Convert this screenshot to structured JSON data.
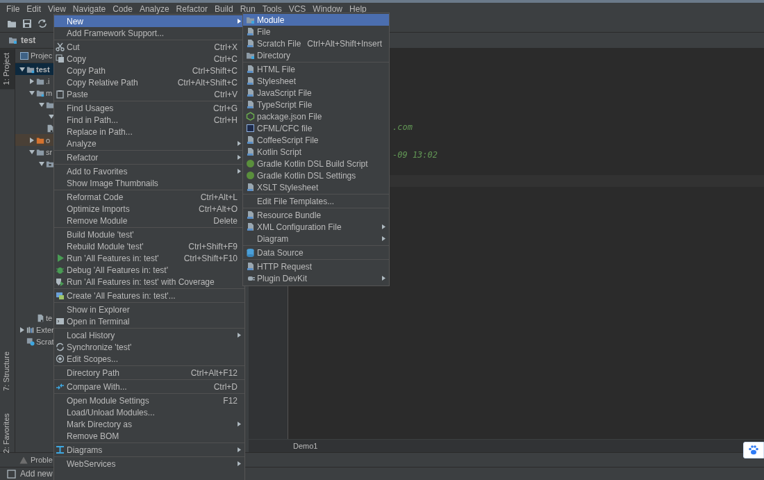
{
  "menu_bar": [
    "File",
    "Edit",
    "View",
    "Navigate",
    "Code",
    "Analyze",
    "Refactor",
    "Build",
    "Run",
    "Tools",
    "VCS",
    "Window",
    "Help"
  ],
  "breadcrumb": "test",
  "side_tabs": [
    {
      "label": "1: Project",
      "selected": true
    },
    {
      "label": "7: Structure",
      "selected": false
    },
    {
      "label": "2: Favorites",
      "selected": false
    }
  ],
  "project_panel": {
    "title": "Projec",
    "tree": [
      {
        "label": "test",
        "kind": "module",
        "expanded": true,
        "selected": true,
        "children": [
          {
            "label": ".i",
            "kind": "folder",
            "expanded": false,
            "selected": false
          },
          {
            "label": "m",
            "kind": "module",
            "expanded": true,
            "selected": false,
            "children": [
              {
                "kind": "folder",
                "expanded": true,
                "selected": false,
                "children": [
                  {
                    "expanded": true,
                    "selected": false
                  }
                ]
              },
              {
                "kind": "file",
                "selected": false
              }
            ]
          },
          {
            "label": "o",
            "kind": "output-folder",
            "expanded": false,
            "selected": false
          },
          {
            "label": "sr",
            "kind": "folder",
            "expanded": true,
            "selected": false,
            "children": [
              {
                "kind": "package",
                "expanded": true,
                "selected": false
              }
            ]
          },
          {
            "label": "te",
            "kind": "file",
            "selected": false
          }
        ]
      },
      {
        "label": "Exter",
        "kind": "library",
        "expanded": false,
        "selected": false
      },
      {
        "label": "Scrat",
        "kind": "scratch",
        "selected": false
      }
    ]
  },
  "editor": {
    "lines": [
      ".com",
      "-09 13:02"
    ],
    "tab": "Demo1"
  },
  "bottom_tool": {
    "label": "Proble"
  },
  "status_bar": "Add new",
  "context_menu": [
    {
      "kind": "item",
      "label": "New",
      "submenu": true,
      "selected": true
    },
    {
      "kind": "item",
      "label": "Add Framework Support...",
      "selected": false
    },
    {
      "kind": "separator"
    },
    {
      "kind": "item",
      "label": "Cut",
      "shortcut": "Ctrl+X",
      "selected": false
    },
    {
      "kind": "item",
      "label": "Copy",
      "shortcut": "Ctrl+C",
      "selected": false
    },
    {
      "kind": "item",
      "label": "Copy Path",
      "shortcut": "Ctrl+Shift+C",
      "selected": false
    },
    {
      "kind": "item",
      "label": "Copy Relative Path",
      "shortcut": "Ctrl+Alt+Shift+C",
      "selected": false
    },
    {
      "kind": "item",
      "label": "Paste",
      "shortcut": "Ctrl+V",
      "selected": false
    },
    {
      "kind": "separator"
    },
    {
      "kind": "item",
      "label": "Find Usages",
      "shortcut": "Ctrl+G",
      "selected": false
    },
    {
      "kind": "item",
      "label": "Find in Path...",
      "shortcut": "Ctrl+H",
      "selected": false
    },
    {
      "kind": "item",
      "label": "Replace in Path...",
      "selected": false
    },
    {
      "kind": "item",
      "label": "Analyze",
      "submenu": true,
      "selected": false
    },
    {
      "kind": "separator"
    },
    {
      "kind": "item",
      "label": "Refactor",
      "submenu": true,
      "selected": false
    },
    {
      "kind": "separator"
    },
    {
      "kind": "item",
      "label": "Add to Favorites",
      "submenu": true,
      "selected": false
    },
    {
      "kind": "item",
      "label": "Show Image Thumbnails",
      "selected": false
    },
    {
      "kind": "separator"
    },
    {
      "kind": "item",
      "label": "Reformat Code",
      "shortcut": "Ctrl+Alt+L",
      "selected": false
    },
    {
      "kind": "item",
      "label": "Optimize Imports",
      "shortcut": "Ctrl+Alt+O",
      "selected": false
    },
    {
      "kind": "item",
      "label": "Remove Module",
      "shortcut": "Delete",
      "selected": false
    },
    {
      "kind": "separator"
    },
    {
      "kind": "item",
      "label": "Build Module 'test'",
      "selected": false
    },
    {
      "kind": "item",
      "label": "Rebuild Module 'test'",
      "shortcut": "Ctrl+Shift+F9",
      "selected": false
    },
    {
      "kind": "item",
      "label": "Run 'All Features in: test'",
      "shortcut": "Ctrl+Shift+F10",
      "selected": false
    },
    {
      "kind": "item",
      "label": "Debug 'All Features in: test'",
      "selected": false
    },
    {
      "kind": "item",
      "label": "Run 'All Features in: test' with Coverage",
      "selected": false
    },
    {
      "kind": "separator"
    },
    {
      "kind": "item",
      "label": "Create 'All Features in: test'...",
      "selected": false
    },
    {
      "kind": "separator"
    },
    {
      "kind": "item",
      "label": "Show in Explorer",
      "selected": false
    },
    {
      "kind": "item",
      "label": "Open in Terminal",
      "selected": false
    },
    {
      "kind": "separator"
    },
    {
      "kind": "item",
      "label": "Local History",
      "submenu": true,
      "selected": false
    },
    {
      "kind": "item",
      "label": "Synchronize 'test'",
      "selected": false
    },
    {
      "kind": "item",
      "label": "Edit Scopes...",
      "selected": false
    },
    {
      "kind": "separator"
    },
    {
      "kind": "item",
      "label": "Directory Path",
      "shortcut": "Ctrl+Alt+F12",
      "selected": false
    },
    {
      "kind": "separator"
    },
    {
      "kind": "item",
      "label": "Compare With...",
      "shortcut": "Ctrl+D",
      "selected": false
    },
    {
      "kind": "separator"
    },
    {
      "kind": "item",
      "label": "Open Module Settings",
      "shortcut": "F12",
      "selected": false
    },
    {
      "kind": "item",
      "label": "Load/Unload Modules...",
      "selected": false
    },
    {
      "kind": "item",
      "label": "Mark Directory as",
      "submenu": true,
      "selected": false
    },
    {
      "kind": "item",
      "label": "Remove BOM",
      "selected": false
    },
    {
      "kind": "separator"
    },
    {
      "kind": "item",
      "label": "Diagrams",
      "submenu": true,
      "selected": false
    },
    {
      "kind": "separator"
    },
    {
      "kind": "item",
      "label": "WebServices",
      "submenu": true,
      "selected": false
    }
  ],
  "new_submenu": [
    {
      "kind": "item",
      "label": "Module",
      "selected": true
    },
    {
      "kind": "item",
      "label": "File",
      "selected": false
    },
    {
      "kind": "item",
      "label": "Scratch File",
      "shortcut": "Ctrl+Alt+Shift+Insert",
      "selected": false
    },
    {
      "kind": "item",
      "label": "Directory",
      "selected": false
    },
    {
      "kind": "separator"
    },
    {
      "kind": "item",
      "label": "HTML File",
      "selected": false
    },
    {
      "kind": "item",
      "label": "Stylesheet",
      "selected": false
    },
    {
      "kind": "item",
      "label": "JavaScript File",
      "selected": false
    },
    {
      "kind": "item",
      "label": "TypeScript File",
      "selected": false
    },
    {
      "kind": "item",
      "label": "package.json File",
      "selected": false
    },
    {
      "kind": "item",
      "label": "CFML/CFC file",
      "selected": false
    },
    {
      "kind": "item",
      "label": "CoffeeScript File",
      "selected": false
    },
    {
      "kind": "item",
      "label": "Kotlin Script",
      "selected": false
    },
    {
      "kind": "item",
      "label": "Gradle Kotlin DSL Build Script",
      "selected": false
    },
    {
      "kind": "item",
      "label": "Gradle Kotlin DSL Settings",
      "selected": false
    },
    {
      "kind": "item",
      "label": "XSLT Stylesheet",
      "selected": false
    },
    {
      "kind": "separator"
    },
    {
      "kind": "item",
      "label": "Edit File Templates...",
      "selected": false
    },
    {
      "kind": "separator"
    },
    {
      "kind": "item",
      "label": "Resource Bundle",
      "selected": false
    },
    {
      "kind": "item",
      "label": "XML Configuration File",
      "submenu": true,
      "selected": false
    },
    {
      "kind": "item",
      "label": "Diagram",
      "submenu": true,
      "selected": false
    },
    {
      "kind": "separator"
    },
    {
      "kind": "item",
      "label": "Data Source",
      "selected": false
    },
    {
      "kind": "separator"
    },
    {
      "kind": "item",
      "label": "HTTP Request",
      "selected": false
    },
    {
      "kind": "item",
      "label": "Plugin DevKit",
      "submenu": true,
      "selected": false
    }
  ]
}
